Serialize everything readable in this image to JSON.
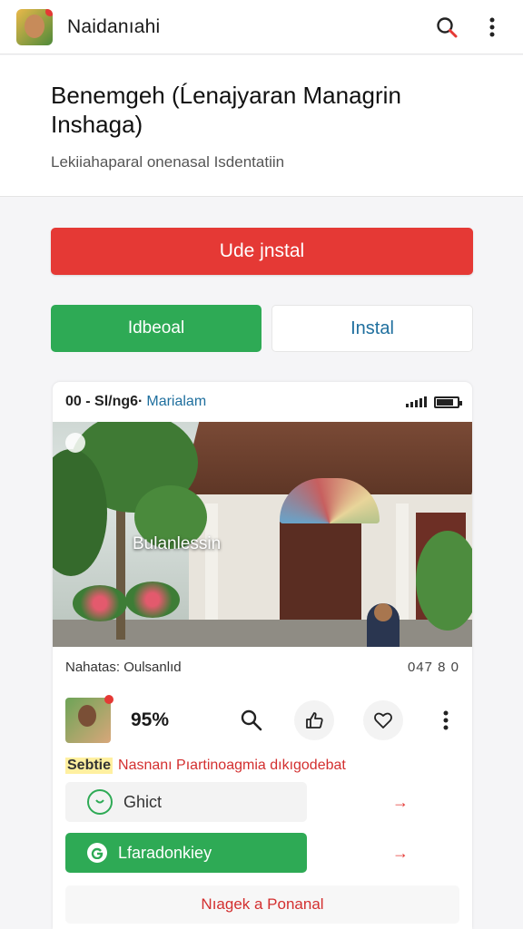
{
  "app": {
    "title": "Naidanıahi"
  },
  "header": {
    "title": "Benemgeh (Ĺenajyaran Managrin Inshaga)",
    "subtitle": "Lekiiahaparal onenasal Isdentatiin"
  },
  "actions": {
    "primary_label": "Ude jnstal",
    "secondary_label": "Idbeoal",
    "install_label": "Instal"
  },
  "preview": {
    "status_left": "00 - Sl/ng6·",
    "status_link": "Marialam",
    "photo_caption": "Bulanlessin",
    "meta_left": "Nahatas: Oulsanlıd",
    "meta_right": "047 8 0",
    "percent": "95%",
    "tag_label": "Sebtie",
    "tag_text": "Nasnanı Pıartinoagmia dıkıgodebat",
    "option_1_label": "Ghict",
    "option_2_label": "Lfaradonkiey",
    "arrow_glyph": "→",
    "footer_label": "Nıagek a Ponanal"
  },
  "icons": {
    "search": "search-icon",
    "more": "more-vert-icon",
    "like": "thumbs-up-icon",
    "favorite": "heart-icon",
    "option_1": "chat-icon",
    "option_2": "google-g-icon"
  },
  "colors": {
    "accent_red": "#e53935",
    "accent_green": "#2eaa55",
    "link_blue": "#1f6f9e"
  }
}
